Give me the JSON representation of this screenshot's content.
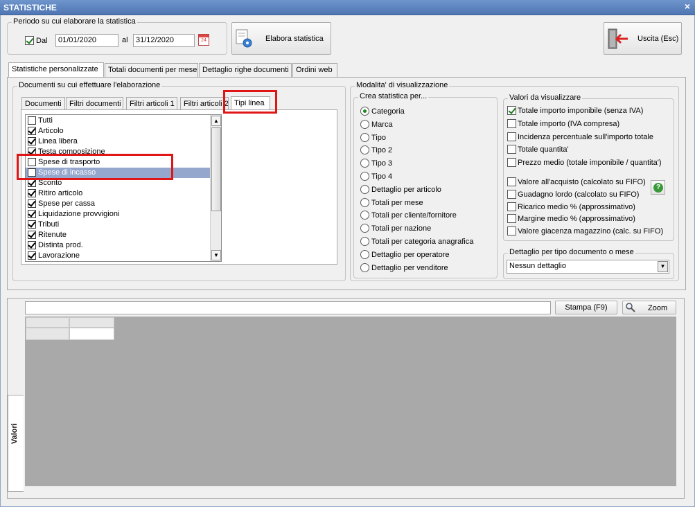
{
  "window": {
    "title": "STATISTICHE",
    "close": "×"
  },
  "period": {
    "legend": "Periodo su cui elaborare la statistica",
    "dal_label": "Dal",
    "dal_checked": true,
    "from_date": "01/01/2020",
    "al_label": "al",
    "to_date": "31/12/2020",
    "calendar_day": "24"
  },
  "buttons": {
    "elabora": "Elabora statistica",
    "uscita": "Uscita (Esc)",
    "stampa": "Stampa (F9)",
    "zoom": "Zoom"
  },
  "main_tabs": [
    "Statistiche personalizzate",
    "Totali documenti per mese",
    "Dettaglio righe documenti",
    "Ordini web"
  ],
  "documents_group": {
    "legend": "Documenti su cui effettuare l'elaborazione",
    "tabs": [
      "Documenti",
      "Filtri documenti",
      "Filtri articoli 1",
      "Filtri articoli 2",
      "Tipi linea"
    ],
    "items": [
      {
        "label": "Tutti",
        "checked": false
      },
      {
        "label": "Articolo",
        "checked": true
      },
      {
        "label": "Linea libera",
        "checked": true
      },
      {
        "label": "Testa composizione",
        "checked": true
      },
      {
        "label": "Spese di trasporto",
        "checked": false
      },
      {
        "label": "Spese di incasso",
        "checked": false
      },
      {
        "label": "Sconto",
        "checked": true
      },
      {
        "label": "Ritiro articolo",
        "checked": true
      },
      {
        "label": "Spese per cassa",
        "checked": true
      },
      {
        "label": "Liquidazione provvigioni",
        "checked": true
      },
      {
        "label": "Tributi",
        "checked": true
      },
      {
        "label": "Ritenute",
        "checked": true
      },
      {
        "label": "Distinta prod.",
        "checked": true
      },
      {
        "label": "Lavorazione",
        "checked": true
      }
    ]
  },
  "view_mode": {
    "legend": "Modalita' di visualizzazione",
    "crea": {
      "legend": "Crea statistica per...",
      "options": [
        "Categoria",
        "Marca",
        "Tipo",
        "Tipo 2",
        "Tipo 3",
        "Tipo 4",
        "Dettaglio per articolo",
        "Totali per mese",
        "Totali per cliente/fornitore",
        "Totali per nazione",
        "Totali per categoria anagrafica",
        "Dettaglio per operatore",
        "Dettaglio per venditore"
      ],
      "selected": "Categoria"
    },
    "valori": {
      "legend": "Valori da visualizzare",
      "items": [
        {
          "label": "Totale importo imponibile (senza IVA)",
          "checked": true
        },
        {
          "label": "Totale importo (IVA compresa)",
          "checked": false
        },
        {
          "label": "Incidenza percentuale sull'importo totale",
          "checked": false
        },
        {
          "label": "Totale quantita'",
          "checked": false
        },
        {
          "label": "Prezzo medio (totale imponibile / quantita')",
          "checked": false
        },
        {
          "label": "Valore all'acquisto (calcolato su FIFO)",
          "checked": false
        },
        {
          "label": "Guadagno lordo (calcolato su FIFO)",
          "checked": false
        },
        {
          "label": "Ricarico medio % (approssimativo)",
          "checked": false
        },
        {
          "label": "Margine medio % (approssimativo)",
          "checked": false
        },
        {
          "label": "Valore giacenza magazzino (calc. su FIFO)",
          "checked": false
        }
      ],
      "help": "?"
    },
    "dettaglio": {
      "legend": "Dettaglio per tipo documento o mese",
      "value": "Nessun dettaglio"
    }
  },
  "results": {
    "side_tab": "Valori",
    "search_value": ""
  },
  "colors": {
    "title_bar": "#5a80bd",
    "highlight": "#96a7ce",
    "annotation": "#e01515",
    "grid_bg": "#a9a9a9"
  }
}
